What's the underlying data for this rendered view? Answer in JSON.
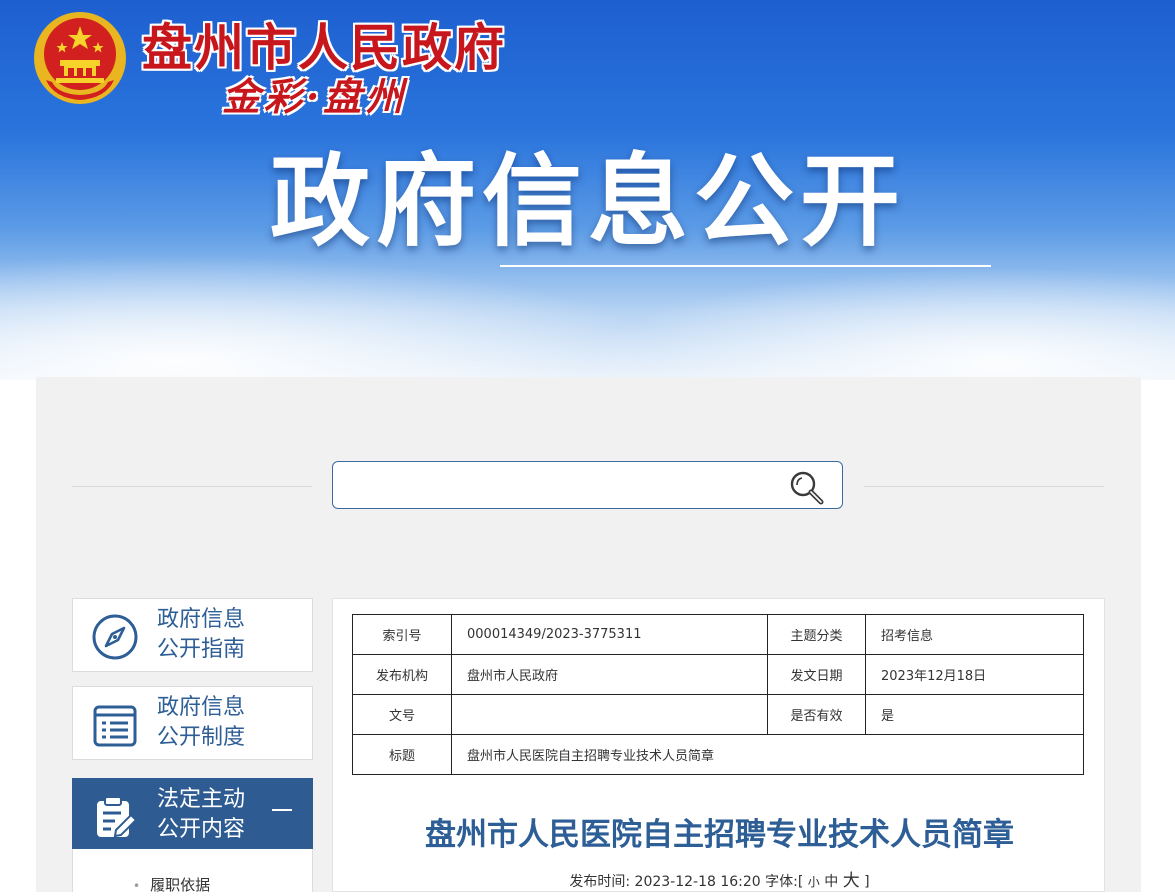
{
  "header": {
    "site_name": "盘州市人民政府",
    "slogan": "金彩·盘州",
    "banner_title": "政府信息公开",
    "emblem_icon": "national-emblem-icon"
  },
  "search": {
    "placeholder": "",
    "icon": "search-icon"
  },
  "sidebar": {
    "items": [
      {
        "label_line1": "政府信息",
        "label_line2": "公开指南",
        "icon": "compass-icon"
      },
      {
        "label_line1": "政府信息",
        "label_line2": "公开制度",
        "icon": "document-list-icon"
      },
      {
        "label_line1": "法定主动",
        "label_line2": "公开内容",
        "icon": "clipboard-edit-icon",
        "expanded": true
      }
    ],
    "sub_items": [
      {
        "label": "履职依据"
      }
    ]
  },
  "meta_table": {
    "index_no_label": "索引号",
    "index_no": "000014349/2023-3775311",
    "topic_label": "主题分类",
    "topic": "招考信息",
    "publisher_label": "发布机构",
    "publisher": "盘州市人民政府",
    "date_label": "发文日期",
    "date": "2023年12月18日",
    "doc_no_label": "文号",
    "doc_no": "",
    "valid_label": "是否有效",
    "valid": "是",
    "title_label": "标题",
    "title": "盘州市人民医院自主招聘专业技术人员简章"
  },
  "article": {
    "title": "盘州市人民医院自主招聘专业技术人员简章",
    "publish_prefix": "发布时间: ",
    "publish_time": "2023-12-18 16:20",
    "font_prefix": " 字体:[ ",
    "font_small": "小",
    "font_medium": "中",
    "font_large": "大",
    "font_suffix": " ]"
  },
  "colors": {
    "brand_red": "#c8161d",
    "nav_blue": "#2d5b92",
    "link_blue": "#2d5e96",
    "panel_grey": "#f1f1f1"
  }
}
